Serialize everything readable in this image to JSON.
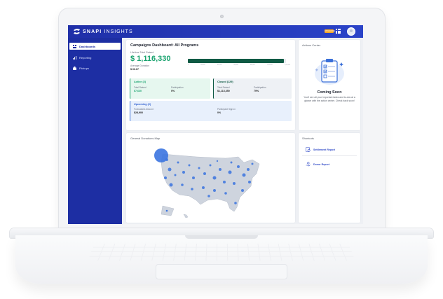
{
  "app": {
    "brand_bold": "SNAPI",
    "brand_light": "INSIGHTS",
    "upgrade_label": "UPGRADE"
  },
  "sidebar": {
    "items": [
      {
        "label": "Dashboards",
        "active": true,
        "icon": "dashboard-icon"
      },
      {
        "label": "Reporting",
        "active": false,
        "icon": "bar-chart-icon"
      },
      {
        "label": "Pickups",
        "active": false,
        "icon": "truck-icon"
      }
    ]
  },
  "dashboard": {
    "title": "Campaigns Dashboard: All Programs",
    "lifetime_label": "Lifetime Total Raised",
    "lifetime_value": "$ 1,116,330",
    "avg_label": "Average Donation",
    "avg_value": "$ 66.67",
    "progress_fraction": 0.98,
    "ticks": [
      "0",
      "200,000",
      "400,000",
      "600,000",
      "800,000",
      "1,000,000",
      "1,200,000"
    ]
  },
  "active": {
    "title": "Active (2)",
    "total_label": "Total Raised",
    "total_value": "$7,630",
    "part_label": "Participation",
    "part_value": "0%"
  },
  "closed": {
    "title": "Closed (129)",
    "total_label": "Total Raised",
    "total_value": "$1,113,350",
    "part_label": "Participation",
    "part_value": "79%"
  },
  "upcoming": {
    "title": "Upcoming (2)",
    "forecast_label": "Forecasted Amount",
    "forecast_value": "$28,900",
    "signin_label": "Participant Sign-In",
    "signin_value": "0%"
  },
  "actions": {
    "title": "Actions Center",
    "coming_soon": "Coming Soon",
    "message": "You'll see all your important tasks and to-dos at a glance with the action center. Check back soon!"
  },
  "map": {
    "title": "General Donations Map"
  },
  "shortcuts": {
    "title": "Shortcuts",
    "items": [
      {
        "label": "Settlement Report",
        "icon": "document-chart-icon"
      },
      {
        "label": "Donor Report",
        "icon": "donor-hand-icon"
      }
    ]
  },
  "colors": {
    "brand": "#1d2ea3",
    "accent_green": "#1aa36f",
    "dark_green": "#0f5a44",
    "link_blue": "#2f49c7"
  }
}
